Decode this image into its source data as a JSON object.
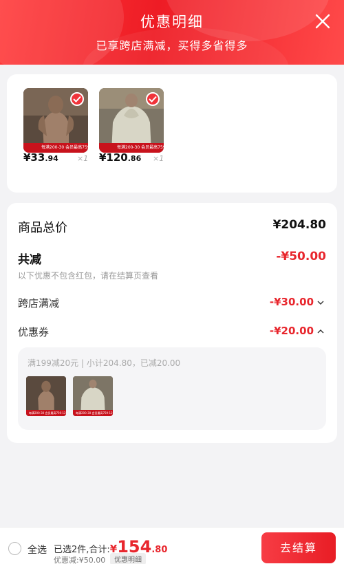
{
  "header": {
    "title": "优惠明细",
    "subtitle": "已享跨店满减，买得多省得多"
  },
  "items": [
    {
      "price_int": "¥33",
      "price_dec": ".94",
      "qty": "×1",
      "banner": "每满200-30 会员最高759-120"
    },
    {
      "price_int": "¥120",
      "price_dec": ".86",
      "qty": "×1",
      "banner": "每满200-30 会员最高759-120"
    }
  ],
  "summary": {
    "total_label": "商品总价",
    "total_value": "¥204.80",
    "reduce_label": "共减",
    "reduce_value": "-¥50.00",
    "reduce_note": "以下优惠不包含红包，请在结算页查看",
    "cross_label": "跨店满减",
    "cross_value": "-¥30.00",
    "coupon_label": "优惠券",
    "coupon_value": "-¥20.00",
    "coupon_detail": "满199减20元 | 小计204.80，已减20.00",
    "mini_banner": "每满200-30 会员最高759-120"
  },
  "bottom": {
    "select_all": "全选",
    "selected_text": "已选2件,合计:",
    "total_yuan": "¥",
    "total_int": "154",
    "total_dec": ".80",
    "discount_text": "优惠减:¥50.00",
    "detail_tag": "优惠明细",
    "checkout": "去结算"
  },
  "colors": {
    "accent": "#e8262d",
    "header": "#ee1c25"
  }
}
